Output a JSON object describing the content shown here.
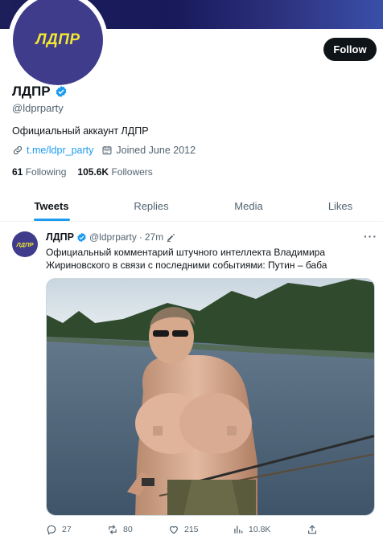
{
  "profile": {
    "logo_text": "ЛДПР",
    "name": "ЛДПР",
    "handle": "@ldprparty",
    "bio": "Официальный аккаунт ЛДПР",
    "link": "t.me/ldpr_party",
    "joined": "Joined June 2012",
    "following_count": "61",
    "following_label": "Following",
    "followers_count": "105.6K",
    "followers_label": "Followers",
    "follow_label": "Follow"
  },
  "tabs": [
    {
      "label": "Tweets",
      "active": true
    },
    {
      "label": "Replies",
      "active": false
    },
    {
      "label": "Media",
      "active": false
    },
    {
      "label": "Likes",
      "active": false
    }
  ],
  "tweet": {
    "avatar_text": "ЛДПР",
    "name": "ЛДПР",
    "handle": "@ldprparty",
    "separator": "·",
    "time": "27m",
    "more": "···",
    "text": "Официальный комментарий штучного интеллекта Владимира Жириновского в связи с последними событиями: Путин – баба",
    "actions": {
      "replies": "27",
      "retweets": "80",
      "likes": "215",
      "views": "10.8K"
    }
  },
  "colors": {
    "accent": "#1d9bf0",
    "brand_purple": "#3f3c8c",
    "brand_yellow": "#f3e832"
  }
}
